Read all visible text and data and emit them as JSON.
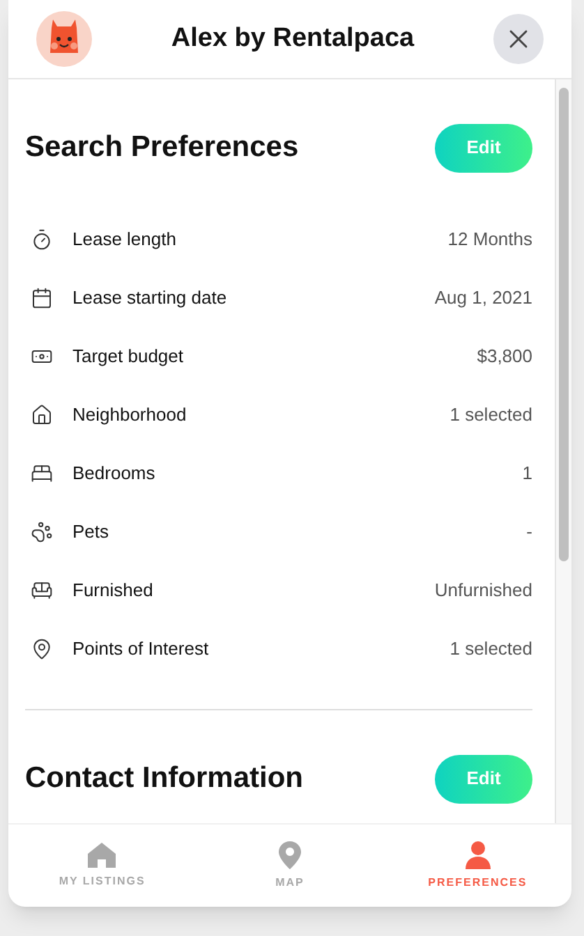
{
  "header": {
    "title": "Alex by Rentalpaca"
  },
  "sections": [
    {
      "title": "Search Preferences",
      "button": "Edit",
      "rows": [
        {
          "label": "Lease length",
          "value": "12 Months"
        },
        {
          "label": "Lease starting date",
          "value": "Aug 1, 2021"
        },
        {
          "label": "Target budget",
          "value": "$3,800"
        },
        {
          "label": "Neighborhood",
          "value": "1 selected"
        },
        {
          "label": "Bedrooms",
          "value": "1"
        },
        {
          "label": "Pets",
          "value": "-"
        },
        {
          "label": "Furnished",
          "value": "Unfurnished"
        },
        {
          "label": "Points of Interest",
          "value": "1 selected"
        }
      ]
    },
    {
      "title": "Contact Information",
      "button": "Edit"
    }
  ],
  "nav": [
    {
      "label": "MY LISTINGS",
      "selected": false
    },
    {
      "label": "MAP",
      "selected": false
    },
    {
      "label": "PREFERENCES",
      "selected": true
    }
  ]
}
